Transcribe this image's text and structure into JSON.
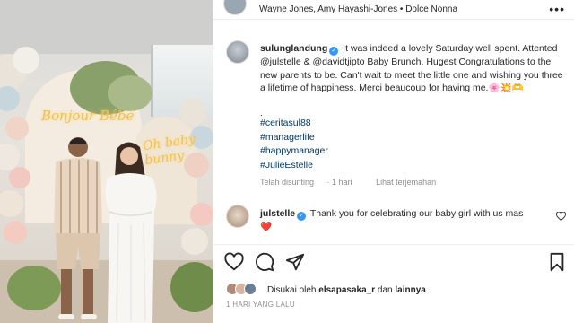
{
  "header": {
    "meta_text": "Wayne Jones, Amy Hayashi-Jones • Dolce Nonna",
    "more_icon": "more-horizontal-icon"
  },
  "photo": {
    "neon_left": "Bonjour Bébé",
    "neon_right": "Oh baby bunny"
  },
  "post": {
    "username": "sulunglandung",
    "caption": "It was indeed a lovely Saturday well spent. Attented @julstelle & @davidtjipto Baby Brunch. Hugest Congratulations to the new parents to be. Can't wait to meet the little one and wishing you three a lifetime of happiness. Merci beaucoup for having me.🌸💥🫶",
    "dot": ".",
    "hashtags": [
      "#ceritasul88",
      "#managerlife",
      "#happymanager",
      "#JulieEstelle"
    ],
    "edited_label": "Telah disunting",
    "time_ago": "1 hari",
    "see_translation": "Lihat terjemahan"
  },
  "comment": {
    "username": "julstelle",
    "text": "Thank you for celebrating our baby girl with us mas❤️"
  },
  "likes": {
    "prefix": "Disukai oleh",
    "user": "elsapasaka_r",
    "conj": "dan",
    "others": "lainnya"
  },
  "date_label": "1 HARI YANG LALU",
  "colors": {
    "link": "#00376b",
    "verified": "#3897f0",
    "muted": "#8e8e8e",
    "heart": "#ed4956"
  }
}
